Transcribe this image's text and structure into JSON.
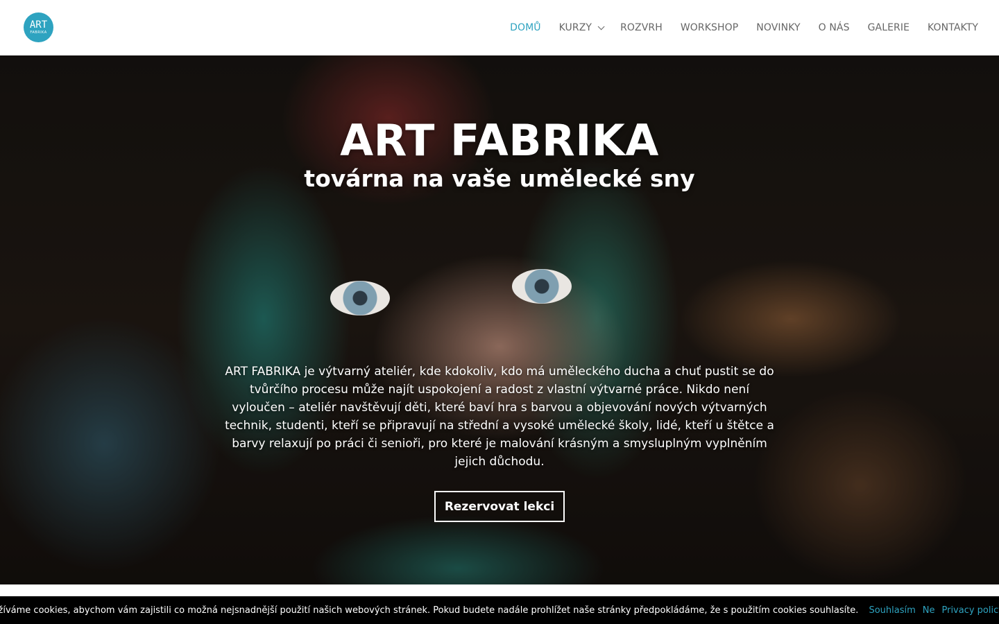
{
  "colors": {
    "accent": "#2ea3c0",
    "nav_text": "#666666",
    "cookie_bg": "#000000"
  },
  "logo": {
    "main": "ART",
    "sub": "FABRIKA"
  },
  "nav": {
    "items": [
      {
        "label": "DOMŮ",
        "active": true
      },
      {
        "label": "KURZY",
        "has_dropdown": true
      },
      {
        "label": "ROZVRH"
      },
      {
        "label": "WORKSHOP"
      },
      {
        "label": "NOVINKY"
      },
      {
        "label": "O NÁS"
      },
      {
        "label": "GALERIE"
      },
      {
        "label": "KONTAKTY"
      }
    ]
  },
  "hero": {
    "title": "ART FABRIKA",
    "subtitle": "továrna na vaše umělecké sny",
    "text": "ART FABRIKA je výtvarný ateliér, kde kdokoliv, kdo má uměleckého ducha a chuť pustit se do tvůrčího procesu může najít uspokojení a radost z vlastní výtvarné práce. Nikdo není vyloučen – ateliér navštěvují děti, které baví hra s barvou a objevování nových výtvarných technik, studenti, kteří se připravují na střední a vysoké umělecké školy, lidé, kteří u štětce a barvy relaxují po práci či senioři, pro které je malování krásným a smysluplným vyplněním jejich důchodu.",
    "button": "Rezervovat lekci"
  },
  "cookie": {
    "message": "Užíváme cookies, abychom vám zajistili co možná nejsnadnější použití našich webových stránek. Pokud budete nadále prohlížet naše stránky předpokládáme, že s použitím cookies souhlasíte.",
    "accept": "Souhlasím",
    "decline": "Ne",
    "privacy": "Privacy policy"
  }
}
